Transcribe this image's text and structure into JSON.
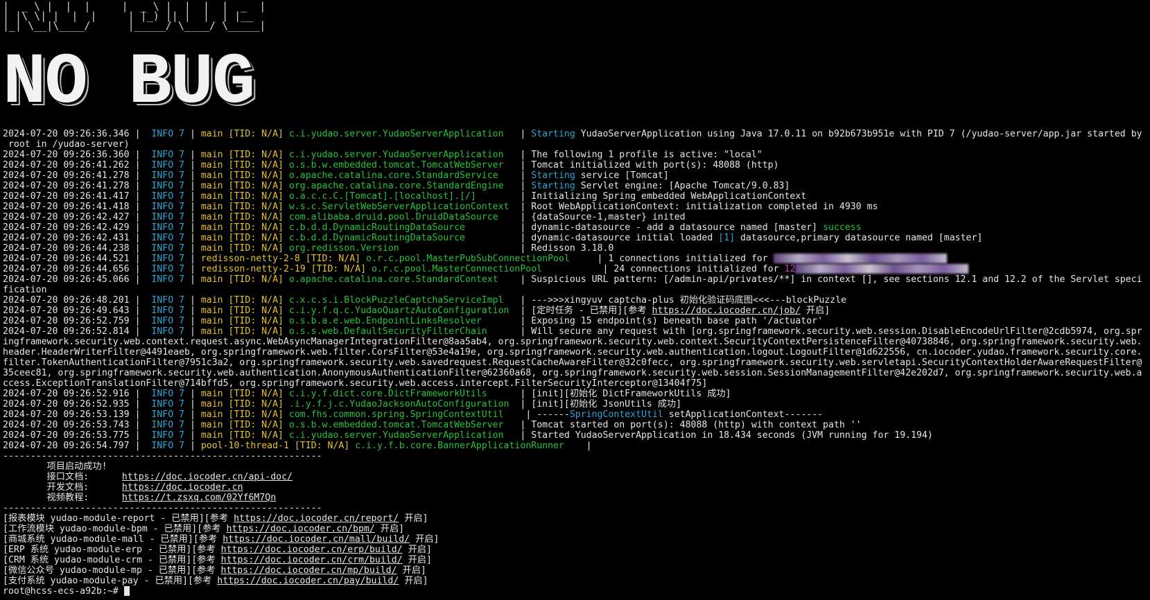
{
  "banner": {
    "small_art_line1": "|  _ \\ |  |  |     |  _ \\ |  |  |  |  _  |",
    "small_art_line2": "| |\\ \\| |  |  |     | |_) || |  |  | |__",
    "small_art_line3": "|_| \\__|\\____/      |_____/ \\____/ \\_____|",
    "big_text": "NO BUG"
  },
  "log_lines": [
    {
      "ts": "2024-07-20 09:26:36.346",
      "lvl": "INFO 7",
      "thr": "main [TID: N/A]",
      "logger": "c.i.yudao.server.YudaoServerApplication  ",
      "pre": "Starting",
      "msg": " YudaoServerApplication using Java 17.0.11 on b92b673b951e with PID 7 (/yudao-server/app.jar started by"
    },
    {
      "cont": " root in /yudao-server)"
    },
    {
      "ts": "2024-07-20 09:26:36.360",
      "lvl": "INFO 7",
      "thr": "main [TID: N/A]",
      "logger": "c.i.yudao.server.YudaoServerApplication  ",
      "msg": "The following 1 profile is active: \"local\""
    },
    {
      "ts": "2024-07-20 09:26:41.262",
      "lvl": "INFO 7",
      "thr": "main [TID: N/A]",
      "logger": "o.s.b.w.embedded.tomcat.TomcatWebServer  ",
      "msg": "Tomcat initialized with port(s): 48088 (http)"
    },
    {
      "ts": "2024-07-20 09:26:41.278",
      "lvl": "INFO 7",
      "thr": "main [TID: N/A]",
      "logger": "o.apache.catalina.core.StandardService   ",
      "pre": "Starting",
      "msg": " service [Tomcat]"
    },
    {
      "ts": "2024-07-20 09:26:41.278",
      "lvl": "INFO 7",
      "thr": "main [TID: N/A]",
      "logger": "org.apache.catalina.core.StandardEngine  ",
      "pre": "Starting",
      "msg": " Servlet engine: [Apache Tomcat/9.0.83]"
    },
    {
      "ts": "2024-07-20 09:26:41.417",
      "lvl": "INFO 7",
      "thr": "main [TID: N/A]",
      "logger": "o.a.c.c.C.[Tomcat].[localhost].[/]       ",
      "msg": "Initializing Spring embedded WebApplicationContext"
    },
    {
      "ts": "2024-07-20 09:26:41.418",
      "lvl": "INFO 7",
      "thr": "main [TID: N/A]",
      "logger": "w.s.c.ServletWebServerApplicationContext ",
      "msg": "Root WebApplicationContext: initialization completed in 4930 ms"
    },
    {
      "ts": "2024-07-20 09:26:42.427",
      "lvl": "INFO 7",
      "thr": "main [TID: N/A]",
      "logger": "com.alibaba.druid.pool.DruidDataSource   ",
      "msg": "{dataSource-1,master} inited"
    },
    {
      "ts": "2024-07-20 09:26:42.429",
      "lvl": "INFO 7",
      "thr": "main [TID: N/A]",
      "logger": "c.b.d.d.DynamicRoutingDataSource         ",
      "msg": "dynamic-datasource - add a datasource named [master] ",
      "post": "success"
    },
    {
      "ts": "2024-07-20 09:26:42.431",
      "lvl": "INFO 7",
      "thr": "main [TID: N/A]",
      "logger": "c.b.d.d.DynamicRoutingDataSource         ",
      "msg": "dynamic-datasource initial loaded ",
      "num": "[1]",
      "msg2": " datasource,primary datasource named [master]"
    },
    {
      "ts": "2024-07-20 09:26:44.238",
      "lvl": "INFO 7",
      "thr": "main [TID: N/A]",
      "logger": "org.redisson.Version                     ",
      "msg": "Redisson 3.18.0"
    },
    {
      "ts": "2024-07-20 09:26:44.521",
      "lvl": "INFO 7",
      "thr": "redisson-netty-2-8 [TID: N/A]",
      "logger": "o.r.c.pool.MasterPubSubConnectionPool    ",
      "msg": "1 connections initialized for ",
      "blur": true
    },
    {
      "ts": "2024-07-20 09:26:44.656",
      "lvl": "INFO 7",
      "thr": "redisson-netty-2-19 [TID: N/A]",
      "logger": "o.r.c.pool.MasterConnectionPool          ",
      "msg": "24 connections initialized for ",
      "purple": "12",
      "blur": true
    },
    {
      "ts": "2024-07-20 09:26:45.066",
      "lvl": "INFO 7",
      "thr": "main [TID: N/A]",
      "logger": "o.apache.catalina.core.StandardContext   ",
      "msg": "Suspicious URL pattern: [/admin-api/privates/**] in context [], see sections 12.1 and 12.2 of the Servlet speci"
    },
    {
      "cont": "fication"
    },
    {
      "ts": "2024-07-20 09:26:48.201",
      "lvl": "INFO 7",
      "thr": "main [TID: N/A]",
      "logger": "c.x.c.s.i.BlockPuzzleCaptchaServiceImpl  ",
      "msg": "--->>>xingyuv captcha-plus 初始化验证码底图<<<---blockPuzzle"
    },
    {
      "ts": "2024-07-20 09:26:49.643",
      "lvl": "INFO 7",
      "thr": "main [TID: N/A]",
      "logger": "c.i.y.f.q.c.YudaoQuartzAutoConfiguration ",
      "msg": "[定时任务 - 已禁用][参考 ",
      "link": "https://doc.iocoder.cn/job/",
      "msg2": " 开启]"
    },
    {
      "ts": "2024-07-20 09:26:52.759",
      "lvl": "INFO 7",
      "thr": "main [TID: N/A]",
      "logger": "o.s.b.a.e.web.EndpointLinksResolver      ",
      "msg": "Exposing 15 endpoint(s) beneath base path '/actuator'"
    },
    {
      "ts": "2024-07-20 09:26:52.814",
      "lvl": "INFO 7",
      "thr": "main [TID: N/A]",
      "logger": "o.s.s.web.DefaultSecurityFilterChain     ",
      "msg": "Will secure any request with [org.springframework.security.web.session.DisableEncodeUrlFilter@2cdb5974, org.spr"
    },
    {
      "cont": "ingframework.security.web.context.request.async.WebAsyncManagerIntegrationFilter@8aa5ab4, org.springframework.security.web.context.SecurityContextPersistenceFilter@40738846, org.springframework.security.web.header.HeaderWriterFilter@4491eaeb, org.springframework.web.filter.CorsFilter@53e4a19e, org.springframework.security.web.authentication.logout.LogoutFilter@1d622556, cn.iocoder.yudao.framework.security.core.filter.TokenAuthenticationFilter@7951c3a2, org.springframework.security.web.savedrequest.RequestCacheAwareFilter@32c0fecc, org.springframework.security.web.servletapi.SecurityContextHolderAwareRequestFilter@35ceec81, org.springframework.security.web.authentication.AnonymousAuthenticationFilter@62360a68, org.springframework.security.web.session.SessionManagementFilter@42e202d7, org.springframework.security.web.access.ExceptionTranslationFilter@714bffd5, org.springframework.security.web.access.intercept.FilterSecurityInterceptor@13404f75]",
      "wrap": true
    },
    {
      "ts": "2024-07-20 09:26:52.916",
      "lvl": "INFO 7",
      "thr": "main [TID: N/A]",
      "logger": "c.i.y.f.dict.core.DictFrameworkUtils     ",
      "msg": "[init][初始化 DictFrameworkUtils 成功]"
    },
    {
      "ts": "2024-07-20 09:26:52.935",
      "lvl": "INFO 7",
      "thr": "main [TID: N/A]",
      "logger": ".i.y.f.j.c.YudaoJacksonAutoConfiguration ",
      "msg": "[init][初始化 JsonUtils 成功]"
    },
    {
      "ts": "2024-07-20 09:26:53.139",
      "lvl": "INFO 7",
      "thr": "main [TID: N/A]",
      "logger": "com.fhs.common.spring.SpringContextUtil   ",
      "msg": "------",
      "blue": "SpringContextUtil",
      "msg2": " setApplicationContext-------"
    },
    {
      "ts": "2024-07-20 09:26:53.743",
      "lvl": "INFO 7",
      "thr": "main [TID: N/A]",
      "logger": "o.s.b.w.embedded.tomcat.TomcatWebServer  ",
      "msg": "Tomcat started on port(s): 48088 (http) with context path ''"
    },
    {
      "ts": "2024-07-20 09:26:53.775",
      "lvl": "INFO 7",
      "thr": "main [TID: N/A]",
      "logger": "c.i.yudao.server.YudaoServerApplication  ",
      "msg": "Started YudaoServerApplication in 18.434 seconds (JVM running for 19.194)"
    },
    {
      "ts": "2024-07-20 09:26:54.797",
      "lvl": "INFO 7",
      "thr": "pool-10-thread-1 [TID: N/A]",
      "logger": "c.i.y.f.b.core.BannerApplicationRunner   ",
      "msg": ""
    }
  ],
  "separator": "----------------------------------------------------------",
  "startup": {
    "title": "项目启动成功!",
    "rows": [
      {
        "label": "接口文档:",
        "link": "https://doc.iocoder.cn/api-doc/"
      },
      {
        "label": "开发文档:",
        "link": "https://doc.iocoder.cn"
      },
      {
        "label": "视频教程:",
        "link": "https://t.zsxq.com/02Yf6M7Qn"
      }
    ]
  },
  "modules": [
    {
      "pre": "[报表模块 yudao-module-report - 已禁用][参考 ",
      "link": "https://doc.iocoder.cn/report/",
      "post": " 开启]"
    },
    {
      "pre": "[工作流模块 yudao-module-bpm - 已禁用][参考 ",
      "link": "https://doc.iocoder.cn/bpm/",
      "post": " 开启]"
    },
    {
      "pre": "[商城系统 yudao-module-mall - 已禁用][参考 ",
      "link": "https://doc.iocoder.cn/mall/build/",
      "post": " 开启]"
    },
    {
      "pre": "[ERP 系统 yudao-module-erp - 已禁用][参考 ",
      "link": "https://doc.iocoder.cn/erp/build/",
      "post": " 开启]"
    },
    {
      "pre": "[CRM 系统 yudao-module-crm - 已禁用][参考 ",
      "link": "https://doc.iocoder.cn/crm/build/",
      "post": " 开启]"
    },
    {
      "pre": "[微信公众号 yudao-module-mp - 已禁用][参考 ",
      "link": "https://doc.iocoder.cn/mp/build/",
      "post": " 开启]"
    },
    {
      "pre": "[支付系统 yudao-module-pay - 已禁用][参考 ",
      "link": "https://doc.iocoder.cn/pay/build/",
      "post": " 开启]"
    }
  ],
  "prompt": "root@hcss-ecs-a92b:~# ",
  "colors": {
    "info": "#29a7d6",
    "thread": "#e6c32a",
    "logger": "#27c23a",
    "text": "#e6e6e6",
    "background": "#000000"
  }
}
